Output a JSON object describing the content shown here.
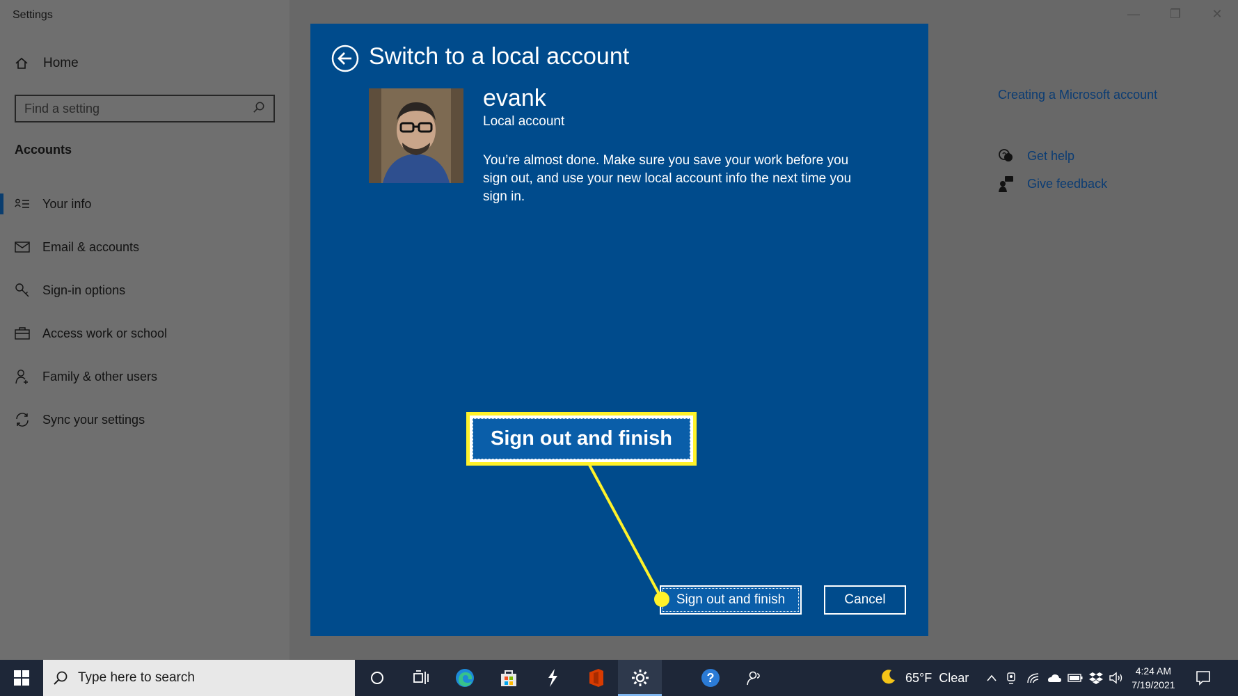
{
  "window": {
    "app_title": "Settings",
    "controls": {
      "minimize": "—",
      "restore": "❐",
      "close": "✕"
    }
  },
  "sidebar": {
    "home_label": "Home",
    "search_placeholder": "Find a setting",
    "section": "Accounts",
    "items": [
      {
        "label": "Your info",
        "icon": "person-card-icon",
        "selected": true
      },
      {
        "label": "Email & accounts",
        "icon": "mail-icon",
        "selected": false
      },
      {
        "label": "Sign-in options",
        "icon": "key-icon",
        "selected": false
      },
      {
        "label": "Access work or school",
        "icon": "briefcase-icon",
        "selected": false
      },
      {
        "label": "Family & other users",
        "icon": "person-add-icon",
        "selected": false
      },
      {
        "label": "Sync your settings",
        "icon": "sync-icon",
        "selected": false
      }
    ]
  },
  "related": {
    "creating_account": "Creating a Microsoft account",
    "get_help": "Get help",
    "give_feedback": "Give feedback"
  },
  "dialog": {
    "title": "Switch to a local account",
    "user_name": "evank",
    "account_type": "Local account",
    "message": "You’re almost done. Make sure you save your work before you sign out, and use your new local account info the next time you sign in.",
    "primary_button": "Sign out and finish",
    "cancel_button": "Cancel"
  },
  "annotation": {
    "callout_text": "Sign out and finish",
    "highlight_color": "#fff22a"
  },
  "taskbar": {
    "search_placeholder": "Type here to search",
    "weather_temp": "65°F",
    "weather_desc": "Clear",
    "time": "4:24 AM",
    "date": "7/19/2021"
  },
  "colors": {
    "dialog_bg": "#004b8c",
    "button_bg": "#0a5ea9",
    "link": "#0b3c73",
    "taskbar": "#1e2738"
  }
}
